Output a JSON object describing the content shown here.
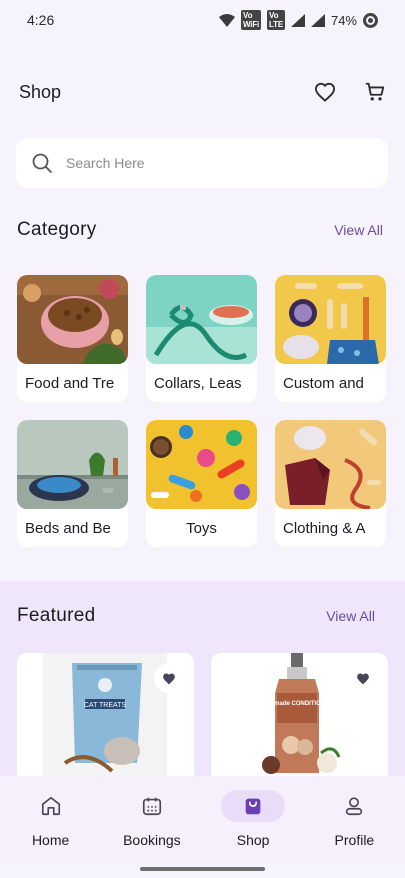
{
  "status_bar": {
    "time": "4:26",
    "volte1": "Vo WiFi 2",
    "volte2": "Vo LTE 1",
    "battery": "74%"
  },
  "app_bar": {
    "title": "Shop",
    "wishlist_icon": "heart-outline-icon",
    "cart_icon": "cart-icon"
  },
  "search": {
    "placeholder": "Search Here",
    "value": ""
  },
  "category": {
    "title": "Category",
    "view_all": "View All",
    "items": [
      {
        "label": "Food and Tre",
        "image": "pet food bowl with kibble"
      },
      {
        "label": "Collars, Leas",
        "image": "teal collar and leash with bowl"
      },
      {
        "label": "Custom and",
        "image": "bone treats and custom pet items"
      },
      {
        "label": "Beds and Be",
        "image": "pet bed on shelf"
      },
      {
        "label": "Toys",
        "image": "colorful pet toys"
      },
      {
        "label": "Clothing & A",
        "image": "pet clothing and accessories"
      }
    ]
  },
  "featured": {
    "title": "Featured",
    "view_all": "View All",
    "products": [
      {
        "name": "CAT TREATS",
        "favorite_icon": "heart-filled-icon"
      },
      {
        "name": "Medimade CONDITIONER",
        "favorite_icon": "heart-filled-icon"
      }
    ]
  },
  "bottom_nav": {
    "items": [
      {
        "label": "Home",
        "icon": "home-icon",
        "active": false
      },
      {
        "label": "Bookings",
        "icon": "calendar-icon",
        "active": false
      },
      {
        "label": "Shop",
        "icon": "shopping-bag-icon",
        "active": true
      },
      {
        "label": "Profile",
        "icon": "person-icon",
        "active": false
      }
    ]
  },
  "colors": {
    "background": "#f7f3fd",
    "accent": "#6b4aa0",
    "featured_band": "#efe6fb",
    "nav_active": "#e8dcf8"
  }
}
